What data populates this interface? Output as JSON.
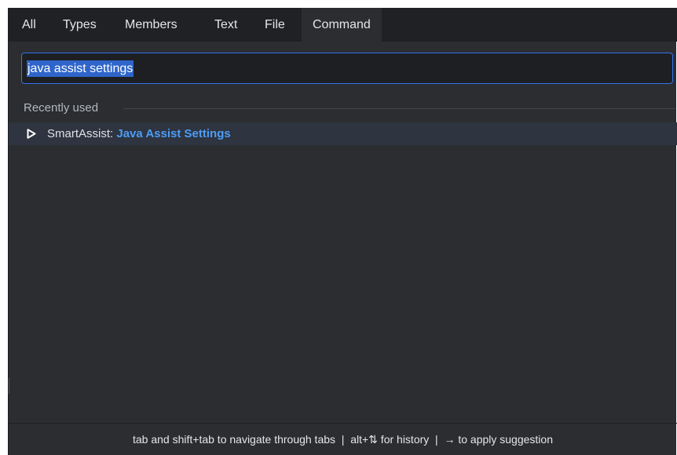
{
  "tabs": [
    {
      "label": "All"
    },
    {
      "label": "Types"
    },
    {
      "label": "Members"
    },
    {
      "label": "Text"
    },
    {
      "label": "File"
    },
    {
      "label": "Command",
      "active": true
    }
  ],
  "search": {
    "value": "java assist settings",
    "selected": true
  },
  "section": {
    "label": "Recently used"
  },
  "results": [
    {
      "icon": "play-icon",
      "prefix": "SmartAssist:",
      "match": "Java Assist Settings"
    }
  ],
  "footer": {
    "hint": "tab and shift+tab to navigate through tabs  |  alt+⇅ for history  |  → to apply suggestion"
  },
  "colors": {
    "panel_bg": "#2b2d30",
    "tabbar_bg": "#202124",
    "accent": "#3574f0",
    "selection": "#2f65ca",
    "match_text": "#4c9df5",
    "row_highlight": "#2e3440"
  }
}
